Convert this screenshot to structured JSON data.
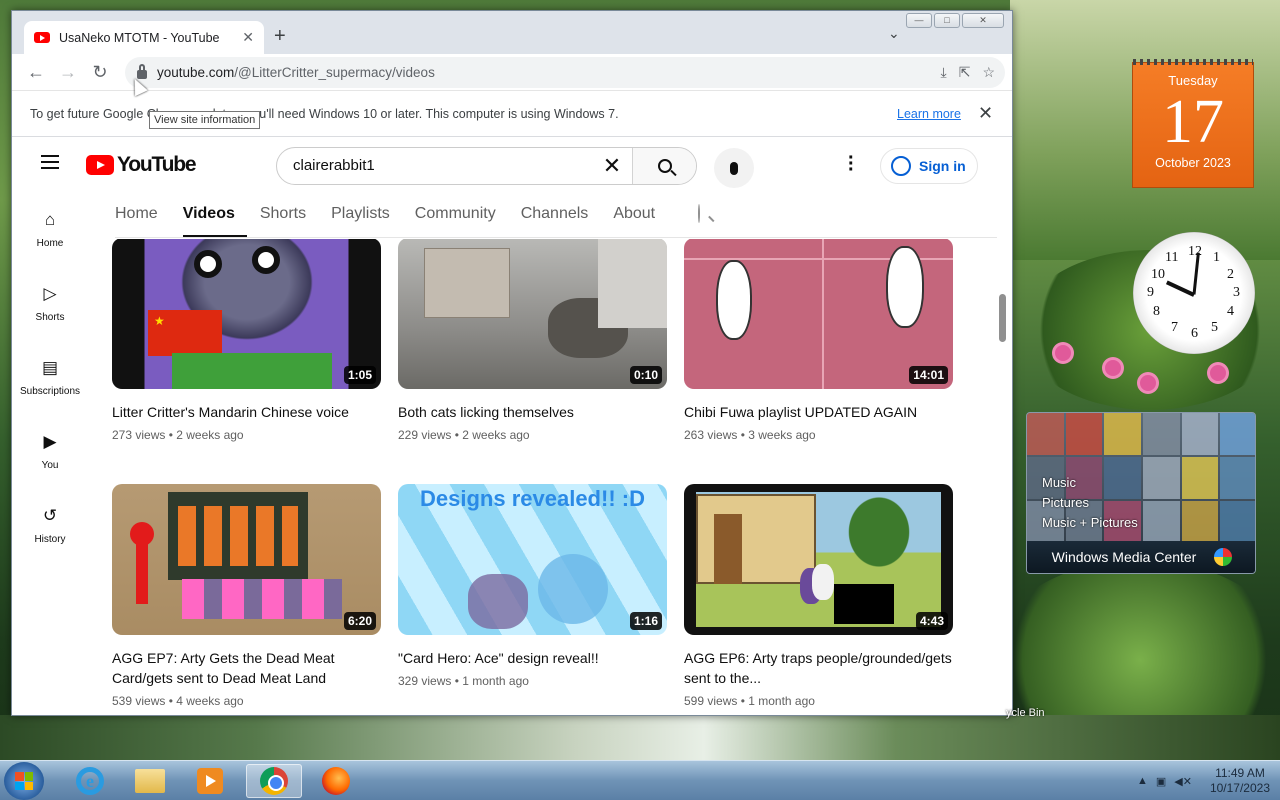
{
  "browser": {
    "tab_title": "UsaNeko MTOTM - YouTube",
    "url_host": "youtube.com",
    "url_path": "/@LitterCritter_supermacy/videos",
    "tooltip": "View site information"
  },
  "infobar": {
    "message": "To get future Google Chrome updates, you'll need Windows 10 or later. This computer is using Windows 7.",
    "learn_more": "Learn more"
  },
  "youtube": {
    "logo_text": "YouTube",
    "search_query": "clairerabbit1",
    "sign_in": "Sign in",
    "guide": [
      {
        "label": "Home",
        "icon": "home-icon"
      },
      {
        "label": "Shorts",
        "icon": "shorts-icon"
      },
      {
        "label": "Subscriptions",
        "icon": "subscriptions-icon"
      },
      {
        "label": "You",
        "icon": "you-icon"
      },
      {
        "label": "History",
        "icon": "history-icon"
      }
    ],
    "channel_tabs": [
      "Home",
      "Videos",
      "Shorts",
      "Playlists",
      "Community",
      "Channels",
      "About"
    ],
    "active_tab": "Videos",
    "videos": [
      {
        "title": "Litter Critter's Mandarin Chinese voice",
        "meta": "273 views • 2 weeks ago",
        "duration": "1:05"
      },
      {
        "title": "Both cats licking themselves",
        "meta": "229 views • 2 weeks ago",
        "duration": "0:10"
      },
      {
        "title": "Chibi Fuwa playlist UPDATED AGAIN",
        "meta": "263 views • 3 weeks ago",
        "duration": "14:01"
      },
      {
        "title": "AGG EP7: Arty Gets the Dead Meat Card/gets sent to Dead Meat Land",
        "meta": "539 views • 4 weeks ago",
        "duration": "6:20"
      },
      {
        "title": "\"Card Hero: Ace\" design reveal!!",
        "meta": "329 views • 1 month ago",
        "duration": "1:16",
        "thumb_text": "Designs revealed!! :D"
      },
      {
        "title": "AGG EP6: Arty traps people/grounded/gets sent to the...",
        "meta": "599 views • 1 month ago",
        "duration": "4:43"
      }
    ]
  },
  "gadgets": {
    "calendar": {
      "weekday": "Tuesday",
      "day": "17",
      "month_year": "October 2023"
    },
    "clock_numbers": [
      "12",
      "1",
      "2",
      "3",
      "4",
      "5",
      "6",
      "7",
      "8",
      "9",
      "10",
      "11"
    ],
    "media_center": {
      "items": [
        "Music",
        "Pictures",
        "Music + Pictures"
      ],
      "title": "Windows Media Center"
    },
    "recycle_bin": "ycle Bin"
  },
  "taskbar": {
    "time": "11:49 AM",
    "date": "10/17/2023"
  }
}
